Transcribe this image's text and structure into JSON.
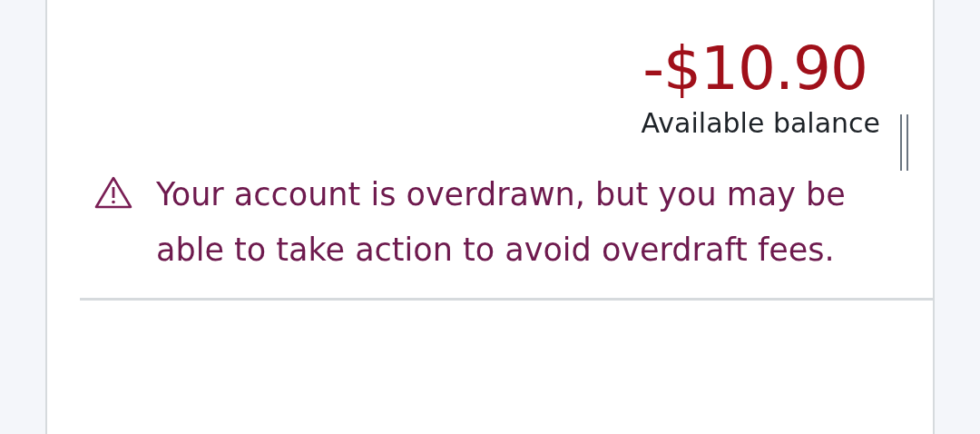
{
  "balance": {
    "amount": "-$10.90",
    "label": "Available balance"
  },
  "alert": {
    "message": "Your account is overdrawn, but you may be able to take action to avoid overdraft fees."
  }
}
